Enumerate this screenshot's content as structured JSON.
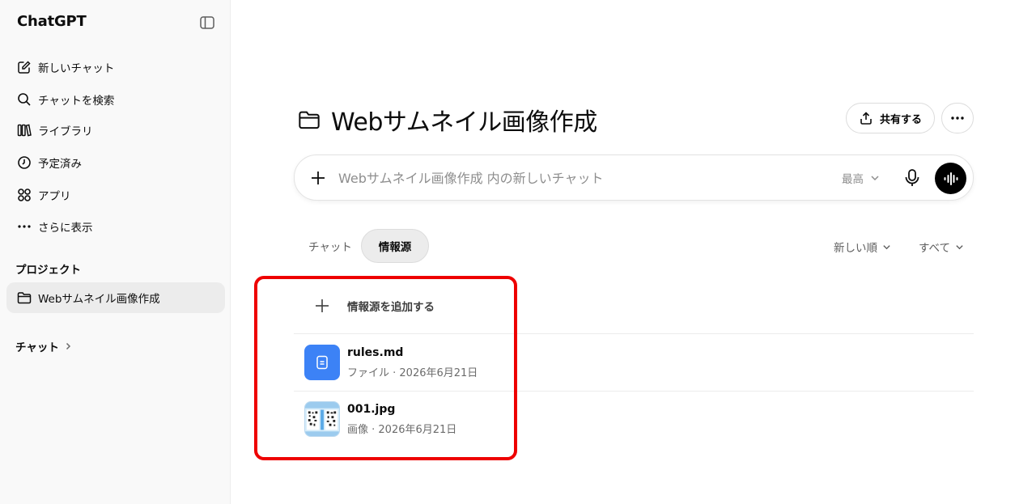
{
  "sidebar": {
    "brand": "ChatGPT",
    "items": [
      {
        "label": "新しいチャット",
        "icon": "new-chat-icon"
      },
      {
        "label": "チャットを検索",
        "icon": "search-icon"
      },
      {
        "label": "ライブラリ",
        "icon": "library-icon"
      },
      {
        "label": "予定済み",
        "icon": "clock-icon"
      },
      {
        "label": "アプリ",
        "icon": "apps-icon"
      },
      {
        "label": "さらに表示",
        "icon": "more-dots-icon"
      }
    ],
    "projects_label": "プロジェクト",
    "project": {
      "label": "Webサムネイル画像作成",
      "icon": "folder-icon"
    },
    "chats_label": "チャット"
  },
  "main": {
    "title": "Webサムネイル画像作成",
    "share_label": "共有する",
    "composer": {
      "placeholder": "Webサムネイル画像作成 内の新しいチャット",
      "model": "最高"
    },
    "tabs": [
      {
        "label": "チャット",
        "active": false
      },
      {
        "label": "情報源",
        "active": true
      }
    ],
    "sort_label": "新しい順",
    "filter_label": "すべて",
    "add_source_label": "情報源を追加する",
    "files": [
      {
        "name": "rules.md",
        "meta": "ファイル · 2026年6月21日",
        "icon": "document-icon"
      },
      {
        "name": "001.jpg",
        "meta": "画像 · 2026年6月21日",
        "icon": "image-thumbnail"
      }
    ]
  },
  "colors": {
    "sidebar_bg": "#f9f9f9",
    "active_item_bg": "#ececec",
    "doc_icon_bg": "#3c82f6",
    "highlight": "#ee0000",
    "voice_button": "#000000"
  }
}
